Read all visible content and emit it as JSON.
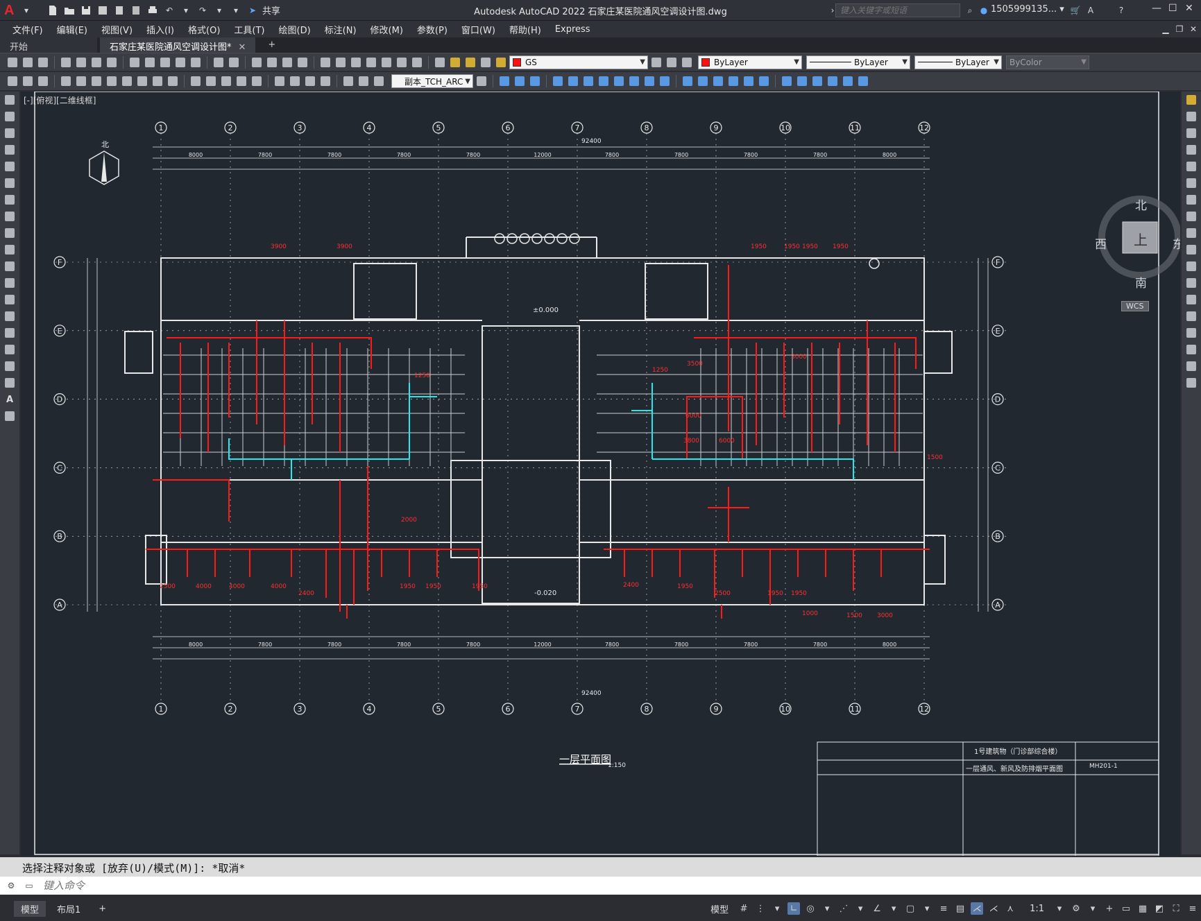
{
  "app": {
    "title": "Autodesk AutoCAD 2022    石家庄某医院通风空调设计图.dwg",
    "search_placeholder": "键入关键字或短语",
    "user": "1505999135... ▾",
    "share": "共享"
  },
  "menu": [
    "文件(F)",
    "编辑(E)",
    "视图(V)",
    "插入(I)",
    "格式(O)",
    "工具(T)",
    "绘图(D)",
    "标注(N)",
    "修改(M)",
    "参数(P)",
    "窗口(W)",
    "帮助(H)",
    "Express"
  ],
  "tabs": {
    "start": "开始",
    "doc": "石家庄某医院通风空调设计图*",
    "add": "+"
  },
  "toolbar": {
    "layer": "GS",
    "color": "ByLayer",
    "linetype": "ByLayer",
    "lineweight": "ByLayer",
    "plotstyle": "ByColor",
    "textstyle": "副本_TCH_ARC"
  },
  "viewport_label": "[-][俯视][二维线框]",
  "viewcube": {
    "north": "北",
    "south": "南",
    "east": "东",
    "west": "西",
    "top": "上",
    "wcs": "WCS"
  },
  "drawing": {
    "grid_cols": [
      "1",
      "2",
      "3",
      "4",
      "5",
      "6",
      "7",
      "8",
      "9",
      "10",
      "11",
      "12"
    ],
    "grid_rows": [
      "F",
      "E",
      "D",
      "C",
      "B",
      "A"
    ],
    "total_dim": "92400",
    "dims_top": [
      "8000",
      "7800",
      "7800",
      "7800",
      "7800",
      "12000",
      "7800",
      "7800",
      "7800",
      "7800",
      "8000"
    ],
    "plan_title": "一层平面图",
    "plan_scale": "1:150",
    "elev_0": "±0.000",
    "elev_1": "-0.020",
    "north_label": "北",
    "titleblock_project": "1号建筑物（门诊部综合楼）",
    "titleblock_sheet": "一层通风、新风及防排烟平面图",
    "titleblock_no": "MH201-1",
    "duct_labels": [
      "3900",
      "3900",
      "1950",
      "1950",
      "1950",
      "1950",
      "1250",
      "1250",
      "6000",
      "3800",
      "4000",
      "4000",
      "4000",
      "2500",
      "2400",
      "1950",
      "1950",
      "1950",
      "3000",
      "1500",
      "2000",
      "6000",
      "1500",
      "2400",
      "2500",
      "1950",
      "1950",
      "1950",
      "1000",
      "3000",
      "3500"
    ]
  },
  "command": {
    "history": "选择注释对象或 [放弃(U)/模式(M)]: *取消*",
    "prompt": "键入命令"
  },
  "status": {
    "model": "模型",
    "layout1": "布局1",
    "add": "+",
    "model_btn": "模型",
    "scale": "1:1"
  }
}
